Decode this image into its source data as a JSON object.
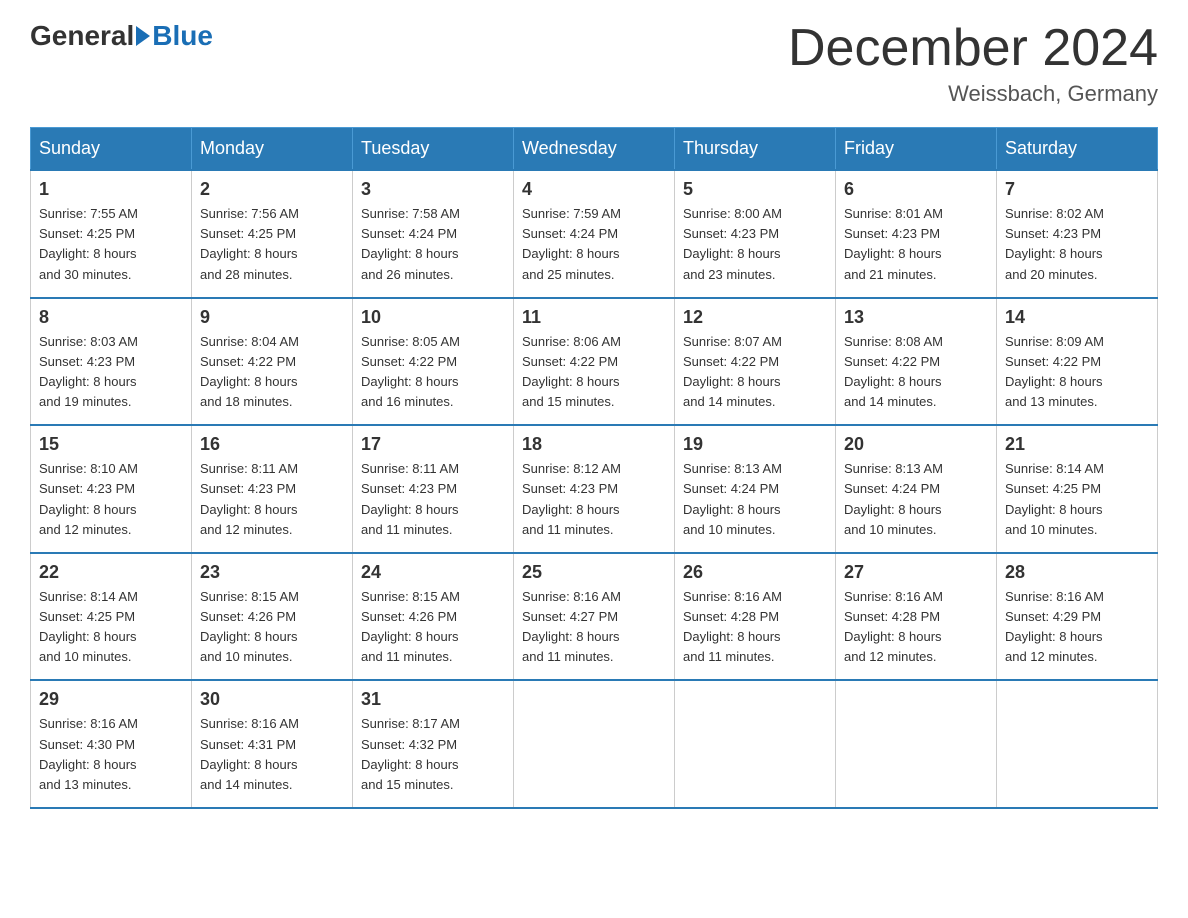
{
  "header": {
    "logo_general": "General",
    "logo_blue": "Blue",
    "month_title": "December 2024",
    "location": "Weissbach, Germany"
  },
  "days_of_week": [
    "Sunday",
    "Monday",
    "Tuesday",
    "Wednesday",
    "Thursday",
    "Friday",
    "Saturday"
  ],
  "weeks": [
    [
      {
        "num": "1",
        "sunrise": "7:55 AM",
        "sunset": "4:25 PM",
        "daylight": "8 hours and 30 minutes."
      },
      {
        "num": "2",
        "sunrise": "7:56 AM",
        "sunset": "4:25 PM",
        "daylight": "8 hours and 28 minutes."
      },
      {
        "num": "3",
        "sunrise": "7:58 AM",
        "sunset": "4:24 PM",
        "daylight": "8 hours and 26 minutes."
      },
      {
        "num": "4",
        "sunrise": "7:59 AM",
        "sunset": "4:24 PM",
        "daylight": "8 hours and 25 minutes."
      },
      {
        "num": "5",
        "sunrise": "8:00 AM",
        "sunset": "4:23 PM",
        "daylight": "8 hours and 23 minutes."
      },
      {
        "num": "6",
        "sunrise": "8:01 AM",
        "sunset": "4:23 PM",
        "daylight": "8 hours and 21 minutes."
      },
      {
        "num": "7",
        "sunrise": "8:02 AM",
        "sunset": "4:23 PM",
        "daylight": "8 hours and 20 minutes."
      }
    ],
    [
      {
        "num": "8",
        "sunrise": "8:03 AM",
        "sunset": "4:23 PM",
        "daylight": "8 hours and 19 minutes."
      },
      {
        "num": "9",
        "sunrise": "8:04 AM",
        "sunset": "4:22 PM",
        "daylight": "8 hours and 18 minutes."
      },
      {
        "num": "10",
        "sunrise": "8:05 AM",
        "sunset": "4:22 PM",
        "daylight": "8 hours and 16 minutes."
      },
      {
        "num": "11",
        "sunrise": "8:06 AM",
        "sunset": "4:22 PM",
        "daylight": "8 hours and 15 minutes."
      },
      {
        "num": "12",
        "sunrise": "8:07 AM",
        "sunset": "4:22 PM",
        "daylight": "8 hours and 14 minutes."
      },
      {
        "num": "13",
        "sunrise": "8:08 AM",
        "sunset": "4:22 PM",
        "daylight": "8 hours and 14 minutes."
      },
      {
        "num": "14",
        "sunrise": "8:09 AM",
        "sunset": "4:22 PM",
        "daylight": "8 hours and 13 minutes."
      }
    ],
    [
      {
        "num": "15",
        "sunrise": "8:10 AM",
        "sunset": "4:23 PM",
        "daylight": "8 hours and 12 minutes."
      },
      {
        "num": "16",
        "sunrise": "8:11 AM",
        "sunset": "4:23 PM",
        "daylight": "8 hours and 12 minutes."
      },
      {
        "num": "17",
        "sunrise": "8:11 AM",
        "sunset": "4:23 PM",
        "daylight": "8 hours and 11 minutes."
      },
      {
        "num": "18",
        "sunrise": "8:12 AM",
        "sunset": "4:23 PM",
        "daylight": "8 hours and 11 minutes."
      },
      {
        "num": "19",
        "sunrise": "8:13 AM",
        "sunset": "4:24 PM",
        "daylight": "8 hours and 10 minutes."
      },
      {
        "num": "20",
        "sunrise": "8:13 AM",
        "sunset": "4:24 PM",
        "daylight": "8 hours and 10 minutes."
      },
      {
        "num": "21",
        "sunrise": "8:14 AM",
        "sunset": "4:25 PM",
        "daylight": "8 hours and 10 minutes."
      }
    ],
    [
      {
        "num": "22",
        "sunrise": "8:14 AM",
        "sunset": "4:25 PM",
        "daylight": "8 hours and 10 minutes."
      },
      {
        "num": "23",
        "sunrise": "8:15 AM",
        "sunset": "4:26 PM",
        "daylight": "8 hours and 10 minutes."
      },
      {
        "num": "24",
        "sunrise": "8:15 AM",
        "sunset": "4:26 PM",
        "daylight": "8 hours and 11 minutes."
      },
      {
        "num": "25",
        "sunrise": "8:16 AM",
        "sunset": "4:27 PM",
        "daylight": "8 hours and 11 minutes."
      },
      {
        "num": "26",
        "sunrise": "8:16 AM",
        "sunset": "4:28 PM",
        "daylight": "8 hours and 11 minutes."
      },
      {
        "num": "27",
        "sunrise": "8:16 AM",
        "sunset": "4:28 PM",
        "daylight": "8 hours and 12 minutes."
      },
      {
        "num": "28",
        "sunrise": "8:16 AM",
        "sunset": "4:29 PM",
        "daylight": "8 hours and 12 minutes."
      }
    ],
    [
      {
        "num": "29",
        "sunrise": "8:16 AM",
        "sunset": "4:30 PM",
        "daylight": "8 hours and 13 minutes."
      },
      {
        "num": "30",
        "sunrise": "8:16 AM",
        "sunset": "4:31 PM",
        "daylight": "8 hours and 14 minutes."
      },
      {
        "num": "31",
        "sunrise": "8:17 AM",
        "sunset": "4:32 PM",
        "daylight": "8 hours and 15 minutes."
      },
      null,
      null,
      null,
      null
    ]
  ],
  "labels": {
    "sunrise": "Sunrise:",
    "sunset": "Sunset:",
    "daylight": "Daylight:"
  }
}
